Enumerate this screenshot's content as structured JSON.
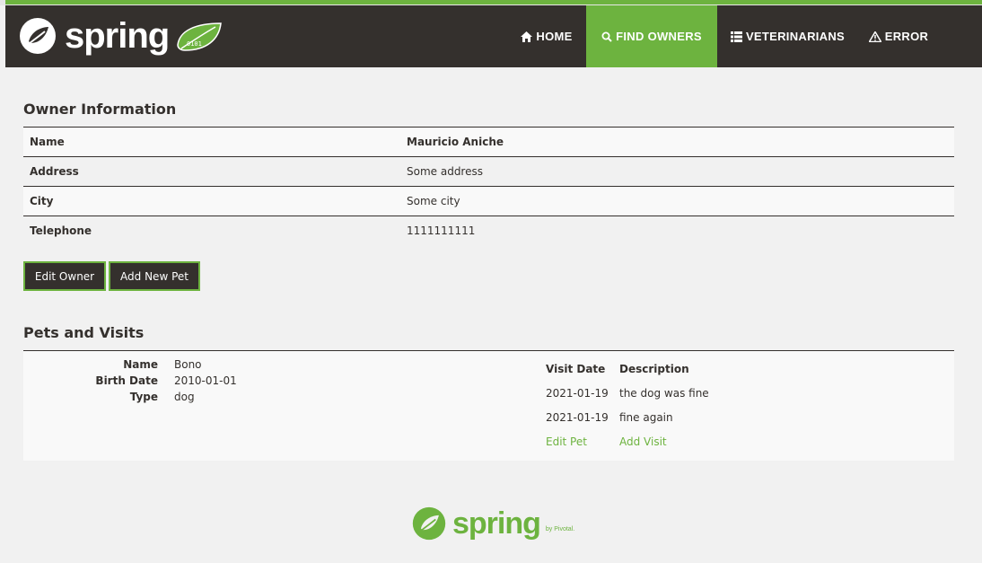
{
  "brand": {
    "name": "spring",
    "leaf_text": "0101"
  },
  "nav": [
    {
      "label": "HOME",
      "icon": "home-icon",
      "active": false
    },
    {
      "label": "FIND OWNERS",
      "icon": "search-icon",
      "active": true
    },
    {
      "label": "VETERINARIANS",
      "icon": "list-icon",
      "active": false
    },
    {
      "label": "ERROR",
      "icon": "warning-icon",
      "active": false
    }
  ],
  "owner": {
    "title": "Owner Information",
    "rows": [
      {
        "label": "Name",
        "value": "Mauricio Aniche"
      },
      {
        "label": "Address",
        "value": "Some address"
      },
      {
        "label": "City",
        "value": "Some city"
      },
      {
        "label": "Telephone",
        "value": "1111111111"
      }
    ],
    "edit_button": "Edit Owner",
    "add_pet_button": "Add New Pet"
  },
  "pets": {
    "title": "Pets and Visits",
    "items": [
      {
        "name_label": "Name",
        "name": "Bono",
        "birth_label": "Birth Date",
        "birth_date": "2010-01-01",
        "type_label": "Type",
        "type": "dog",
        "visits_header": {
          "date": "Visit Date",
          "description": "Description"
        },
        "visits": [
          {
            "date": "2021-01-19",
            "description": "the dog was fine"
          },
          {
            "date": "2021-01-19",
            "description": "fine again"
          }
        ],
        "edit_pet_link": "Edit Pet",
        "add_visit_link": "Add Visit"
      }
    ]
  },
  "footer": {
    "name": "spring",
    "sub": "by Pivotal."
  },
  "colors": {
    "dark": "#34302d",
    "green": "#6db33f",
    "background": "#f1f1f1"
  }
}
